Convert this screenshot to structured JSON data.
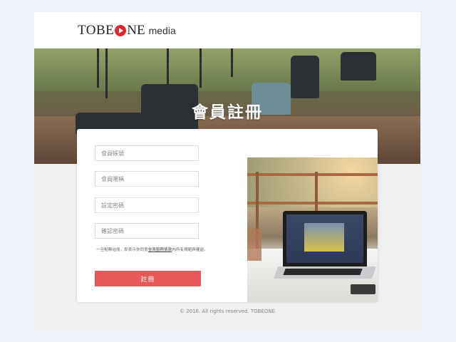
{
  "header": {
    "logo_brand_left": "TOBE",
    "logo_brand_right": "NE",
    "logo_suffix": "media"
  },
  "hero": {
    "title": "會員註冊"
  },
  "form": {
    "account_placeholder": "會員帳號",
    "nickname_placeholder": "會員暱稱",
    "password_placeholder": "設定密碼",
    "confirm_placeholder": "確認密碼",
    "terms_prefix": "一旦點擊註冊，即表示你同意",
    "terms_link": "會員服務條款",
    "terms_suffix": "內所有規範與權益。",
    "submit_label": "註冊"
  },
  "footer": {
    "copyright": "© 2016. All rights reserved. TOBEONE"
  },
  "colors": {
    "accent": "#e8585a",
    "logo_red": "#e3262d",
    "page_bg": "#eef0fb"
  }
}
